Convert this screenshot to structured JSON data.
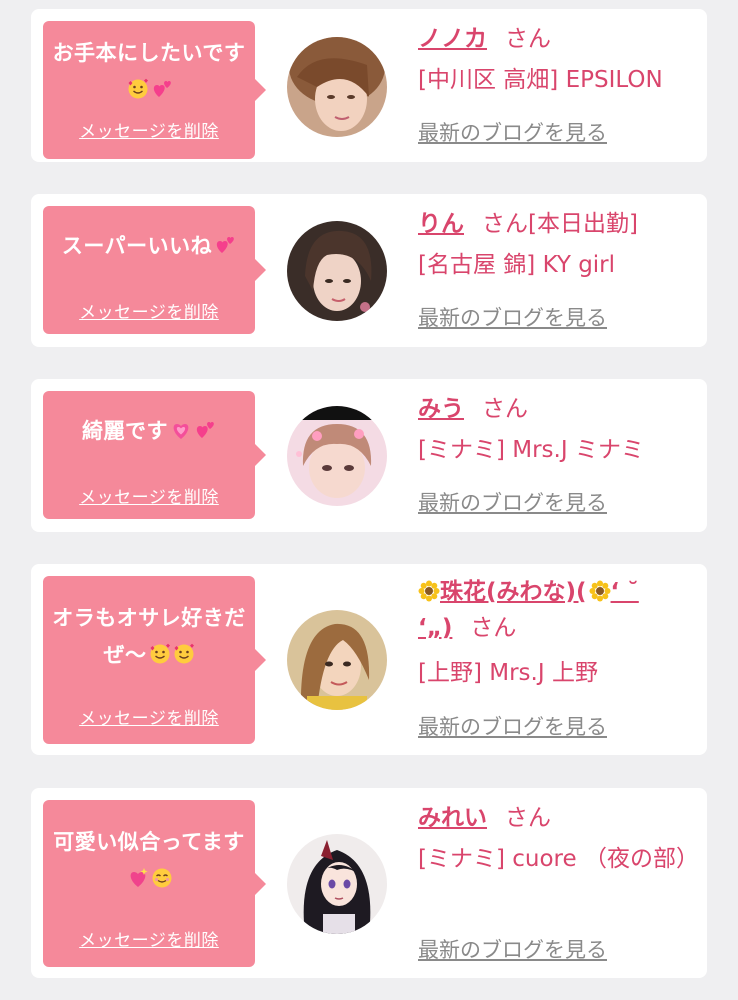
{
  "delete_label": "メッセージを削除",
  "blog_label": "最新のブログを見る",
  "san_label": "さん",
  "colors": {
    "background": "#efeff1",
    "card": "#ffffff",
    "bubble": "#f5899a",
    "accent": "#d9456c",
    "link_gray": "#8a8a8a"
  },
  "cards": [
    {
      "message": "お手本にしたいです",
      "message_emojis": [
        "smiling-face-with-hearts",
        "two-hearts"
      ],
      "name": "ノノカ",
      "status": "",
      "shop": "[中川区 高畑] EPSILON"
    },
    {
      "message": "スーパーいいね",
      "message_emojis": [
        "two-hearts"
      ],
      "name": "りん",
      "status": "[本日出勤]",
      "shop": "[名古屋 錦] KY girl"
    },
    {
      "message": "綺麗です",
      "message_emojis": [
        "growing-heart",
        "two-hearts"
      ],
      "name": "みう",
      "status": "",
      "shop": "[ミナミ] Mrs.J ミナミ"
    },
    {
      "message": "オラもオサレ好きだぜ〜",
      "message_emojis": [
        "smiling-face-with-hearts",
        "smiling-face-with-hearts"
      ],
      "name": "珠花(みわな)(",
      "name_suffix": "‘ ˘",
      "name_line2": "‘„)",
      "shop": "[上野] Mrs.J 上野"
    },
    {
      "message": "可愛い似合ってます",
      "message_emojis": [
        "sparkling-heart",
        "smiling-face"
      ],
      "name": "みれい",
      "status": "",
      "shop": "[ミナミ] cuore （夜の部）"
    }
  ]
}
